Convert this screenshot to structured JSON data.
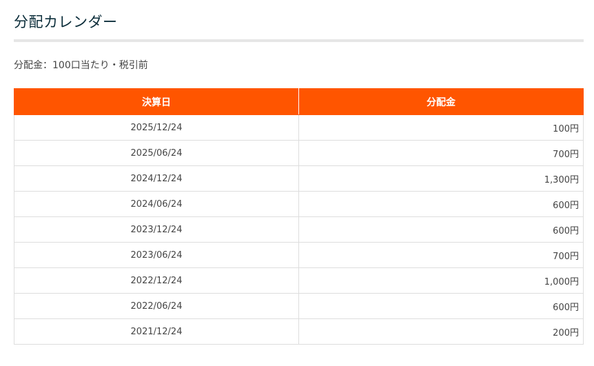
{
  "title": "分配カレンダー",
  "note": "分配金：100口当たり・税引前",
  "table": {
    "headers": [
      "決算日",
      "分配金"
    ],
    "rows": [
      {
        "date": "2025/12/24",
        "amount": "100円"
      },
      {
        "date": "2025/06/24",
        "amount": "700円"
      },
      {
        "date": "2024/12/24",
        "amount": "1,300円"
      },
      {
        "date": "2024/06/24",
        "amount": "600円"
      },
      {
        "date": "2023/12/24",
        "amount": "600円"
      },
      {
        "date": "2023/06/24",
        "amount": "700円"
      },
      {
        "date": "2022/12/24",
        "amount": "1,000円"
      },
      {
        "date": "2022/06/24",
        "amount": "600円"
      },
      {
        "date": "2021/12/24",
        "amount": "200円"
      }
    ]
  },
  "colors": {
    "header_bg": "#ff5500",
    "header_text": "#ffffff",
    "title_text": "#0b2d3a",
    "rule": "#e6e6e6",
    "border": "#dddddd"
  }
}
